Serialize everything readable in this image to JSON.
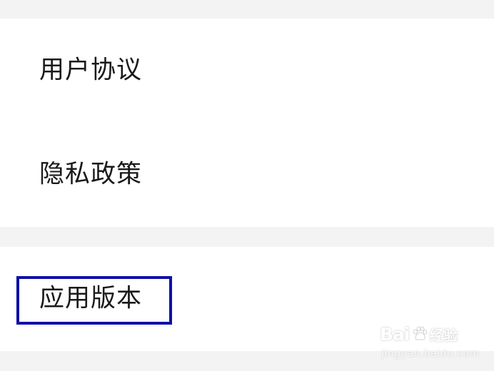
{
  "settings": {
    "items": [
      {
        "label": "用户协议"
      },
      {
        "label": "隐私政策"
      },
      {
        "label": "应用版本"
      }
    ]
  },
  "watermark": {
    "brand": "Bai",
    "brand_suffix": "经验",
    "url": "jingyan.baidu.com"
  },
  "colors": {
    "background": "#f3f3f3",
    "card": "#ffffff",
    "text": "#1a1a1a",
    "highlight": "#1010a8"
  }
}
